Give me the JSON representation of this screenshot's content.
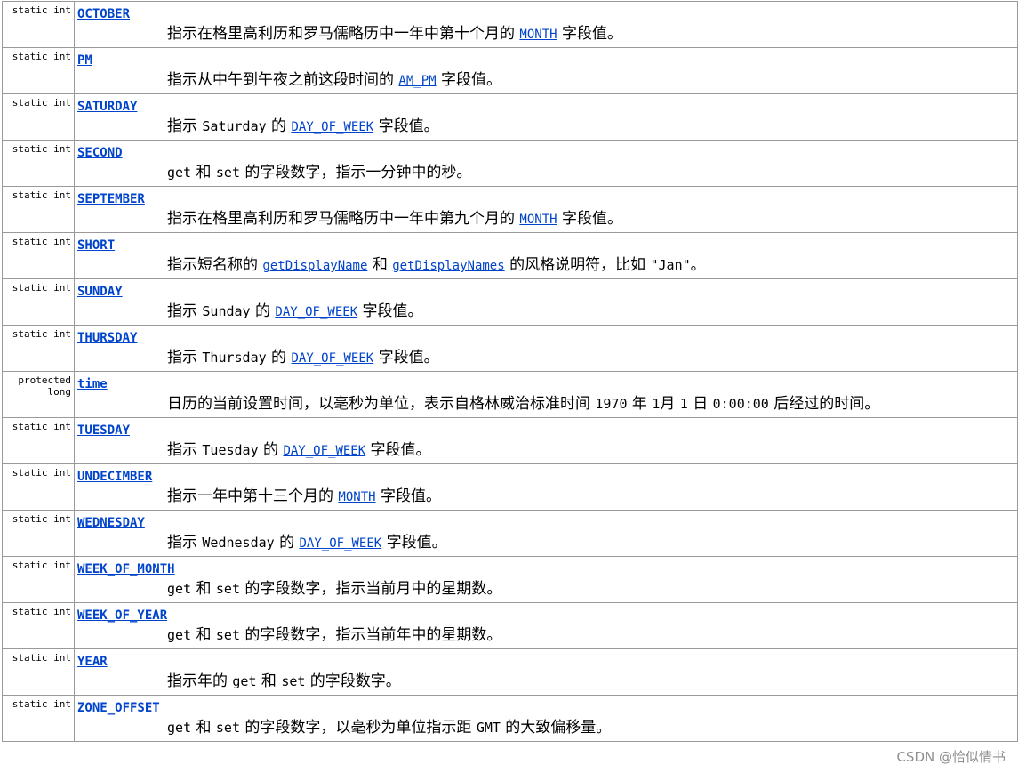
{
  "rows": [
    {
      "modifier": "static int",
      "name": "OCTOBER",
      "desc": [
        {
          "t": "text",
          "v": "指示在格里高利历和罗马儒略历中一年中第十个月的 "
        },
        {
          "t": "link",
          "v": "MONTH"
        },
        {
          "t": "text",
          "v": " 字段值。"
        }
      ]
    },
    {
      "modifier": "static int",
      "name": "PM",
      "desc": [
        {
          "t": "text",
          "v": "指示从中午到午夜之前这段时间的 "
        },
        {
          "t": "link",
          "v": "AM_PM"
        },
        {
          "t": "text",
          "v": " 字段值。"
        }
      ]
    },
    {
      "modifier": "static int",
      "name": "SATURDAY",
      "desc": [
        {
          "t": "text",
          "v": "指示 "
        },
        {
          "t": "mono",
          "v": "Saturday"
        },
        {
          "t": "text",
          "v": " 的 "
        },
        {
          "t": "link",
          "v": "DAY_OF_WEEK"
        },
        {
          "t": "text",
          "v": " 字段值。"
        }
      ]
    },
    {
      "modifier": "static int",
      "name": "SECOND",
      "desc": [
        {
          "t": "mono",
          "v": "get"
        },
        {
          "t": "text",
          "v": " 和 "
        },
        {
          "t": "mono",
          "v": "set"
        },
        {
          "t": "text",
          "v": " 的字段数字，指示一分钟中的秒。"
        }
      ]
    },
    {
      "modifier": "static int",
      "name": "SEPTEMBER",
      "desc": [
        {
          "t": "text",
          "v": "指示在格里高利历和罗马儒略历中一年中第九个月的 "
        },
        {
          "t": "link",
          "v": "MONTH"
        },
        {
          "t": "text",
          "v": " 字段值。"
        }
      ]
    },
    {
      "modifier": "static int",
      "name": "SHORT",
      "desc": [
        {
          "t": "text",
          "v": "指示短名称的 "
        },
        {
          "t": "link",
          "v": "getDisplayName"
        },
        {
          "t": "text",
          "v": " 和 "
        },
        {
          "t": "link",
          "v": "getDisplayNames"
        },
        {
          "t": "text",
          "v": " 的风格说明符，比如 "
        },
        {
          "t": "mono",
          "v": "\"Jan\""
        },
        {
          "t": "text",
          "v": "。"
        }
      ]
    },
    {
      "modifier": "static int",
      "name": "SUNDAY",
      "desc": [
        {
          "t": "text",
          "v": "指示 "
        },
        {
          "t": "mono",
          "v": "Sunday"
        },
        {
          "t": "text",
          "v": " 的 "
        },
        {
          "t": "link",
          "v": "DAY_OF_WEEK"
        },
        {
          "t": "text",
          "v": " 字段值。"
        }
      ]
    },
    {
      "modifier": "static int",
      "name": "THURSDAY",
      "desc": [
        {
          "t": "text",
          "v": "指示 "
        },
        {
          "t": "mono",
          "v": "Thursday"
        },
        {
          "t": "text",
          "v": " 的 "
        },
        {
          "t": "link",
          "v": "DAY_OF_WEEK"
        },
        {
          "t": "text",
          "v": " 字段值。"
        }
      ]
    },
    {
      "modifier": "protected long",
      "name": "time",
      "desc": [
        {
          "t": "text",
          "v": "日历的当前设置时间，以毫秒为单位，表示自格林威治标准时间 "
        },
        {
          "t": "mono",
          "v": "1970"
        },
        {
          "t": "text",
          "v": " 年 "
        },
        {
          "t": "mono",
          "v": "1"
        },
        {
          "t": "text",
          "v": "月 "
        },
        {
          "t": "mono",
          "v": "1"
        },
        {
          "t": "text",
          "v": " 日 "
        },
        {
          "t": "mono",
          "v": "0:00:00"
        },
        {
          "t": "text",
          "v": " 后经过的时间。"
        }
      ]
    },
    {
      "modifier": "static int",
      "name": "TUESDAY",
      "desc": [
        {
          "t": "text",
          "v": "指示 "
        },
        {
          "t": "mono",
          "v": "Tuesday"
        },
        {
          "t": "text",
          "v": " 的 "
        },
        {
          "t": "link",
          "v": "DAY_OF_WEEK"
        },
        {
          "t": "text",
          "v": " 字段值。"
        }
      ]
    },
    {
      "modifier": "static int",
      "name": "UNDECIMBER",
      "desc": [
        {
          "t": "text",
          "v": "指示一年中第十三个月的 "
        },
        {
          "t": "link",
          "v": "MONTH"
        },
        {
          "t": "text",
          "v": " 字段值。"
        }
      ]
    },
    {
      "modifier": "static int",
      "name": "WEDNESDAY",
      "desc": [
        {
          "t": "text",
          "v": "指示 "
        },
        {
          "t": "mono",
          "v": "Wednesday"
        },
        {
          "t": "text",
          "v": " 的 "
        },
        {
          "t": "link",
          "v": "DAY_OF_WEEK"
        },
        {
          "t": "text",
          "v": " 字段值。"
        }
      ]
    },
    {
      "modifier": "static int",
      "name": "WEEK_OF_MONTH",
      "desc": [
        {
          "t": "mono",
          "v": "get"
        },
        {
          "t": "text",
          "v": " 和 "
        },
        {
          "t": "mono",
          "v": "set"
        },
        {
          "t": "text",
          "v": " 的字段数字，指示当前月中的星期数。"
        }
      ]
    },
    {
      "modifier": "static int",
      "name": "WEEK_OF_YEAR",
      "desc": [
        {
          "t": "mono",
          "v": "get"
        },
        {
          "t": "text",
          "v": " 和 "
        },
        {
          "t": "mono",
          "v": "set"
        },
        {
          "t": "text",
          "v": " 的字段数字，指示当前年中的星期数。"
        }
      ]
    },
    {
      "modifier": "static int",
      "name": "YEAR",
      "desc": [
        {
          "t": "text",
          "v": "指示年的 "
        },
        {
          "t": "mono",
          "v": "get"
        },
        {
          "t": "text",
          "v": " 和 "
        },
        {
          "t": "mono",
          "v": "set"
        },
        {
          "t": "text",
          "v": " 的字段数字。"
        }
      ]
    },
    {
      "modifier": "static int",
      "name": "ZONE_OFFSET",
      "desc": [
        {
          "t": "mono",
          "v": "get"
        },
        {
          "t": "text",
          "v": " 和 "
        },
        {
          "t": "mono",
          "v": "set"
        },
        {
          "t": "text",
          "v": " 的字段数字，以毫秒为单位指示距 "
        },
        {
          "t": "mono",
          "v": "GMT"
        },
        {
          "t": "text",
          "v": " 的大致偏移量。"
        }
      ]
    }
  ],
  "watermark": "CSDN @恰似情书",
  "colors": {
    "link": "#0044cc",
    "border": "#9a9a9a",
    "watermark": "#8f8f8f"
  }
}
